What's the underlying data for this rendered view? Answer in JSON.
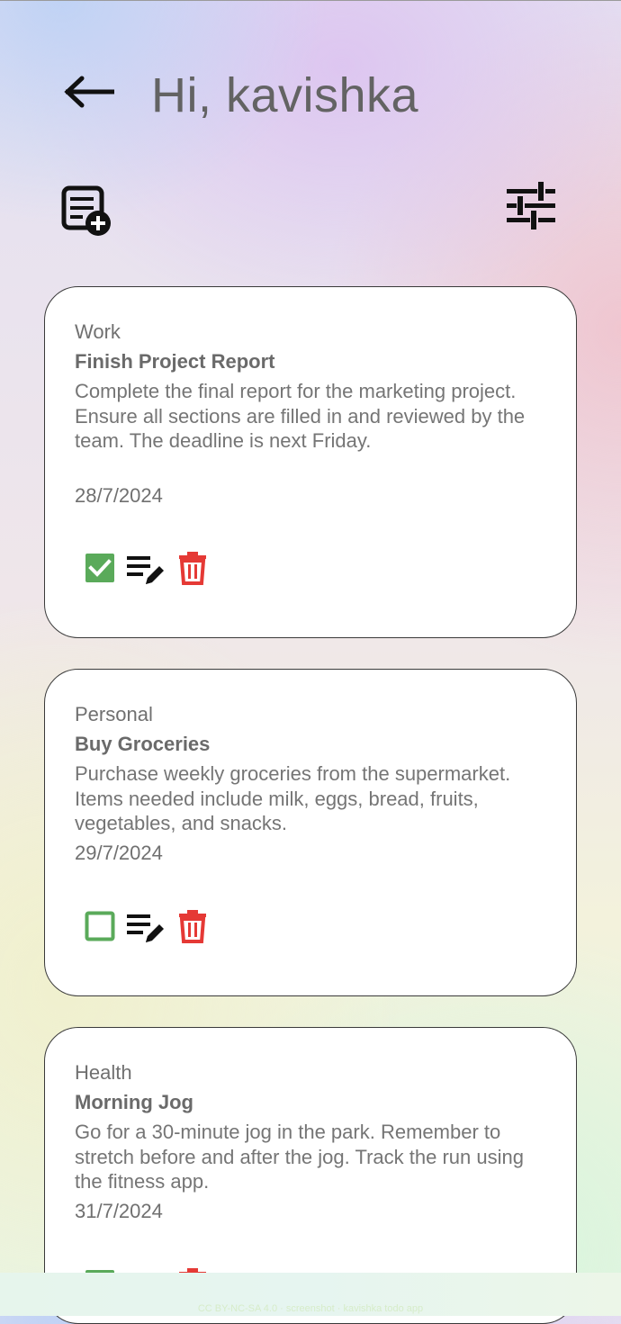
{
  "header": {
    "greeting": "Hi, kavishka",
    "back_icon": "arrow-left-icon",
    "add_note_icon": "note-add-icon",
    "filter_icon": "tune-sliders-icon"
  },
  "tasks": [
    {
      "category": "Work",
      "title": "Finish Project Report",
      "description": "Complete the final report for the marketing project. Ensure all sections are filled in and reviewed by the team. The deadline is next Friday.",
      "date": "28/7/2024",
      "completed": true
    },
    {
      "category": "Personal",
      "title": "Buy Groceries",
      "description": "Purchase weekly groceries from the supermarket. Items needed include milk, eggs, bread, fruits, vegetables, and snacks.",
      "date": "29/7/2024",
      "completed": false
    },
    {
      "category": "Health",
      "title": "Morning Jog",
      "description": "Go for a 30-minute jog in the park. Remember to stretch before and after the jog. Track the run using the fitness app.",
      "date": "31/7/2024",
      "completed": true
    }
  ],
  "footer": {
    "credit": "CC BY-NC-SA 4.0 · screenshot · kavishka todo app"
  },
  "colors": {
    "check_green": "#5aaa5a",
    "delete_red": "#e53935",
    "icon_black": "#111111"
  }
}
